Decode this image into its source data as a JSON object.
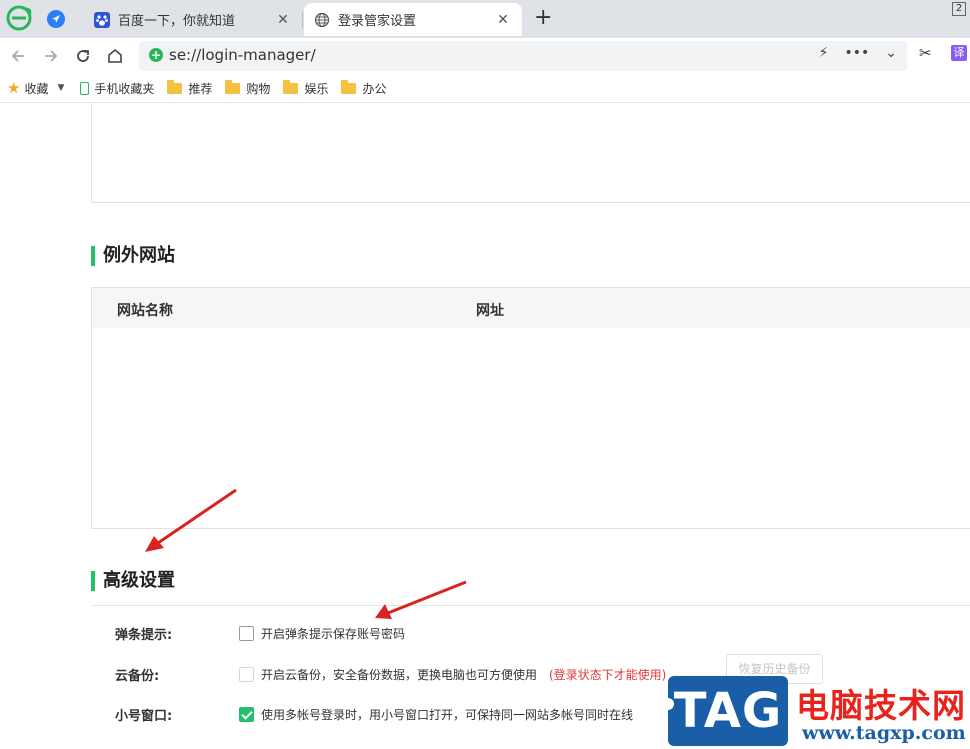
{
  "tabs": [
    {
      "label": "百度一下，你就知道",
      "icon": "baidu-paw-icon"
    },
    {
      "label": "登录管家设置",
      "icon": "globe-icon",
      "active": true
    }
  ],
  "tab_count": "2",
  "address": {
    "url": "se://login-manager/"
  },
  "bookmarks": {
    "favorites": "收藏",
    "mobile": "手机收藏夹",
    "folders": [
      "推荐",
      "购物",
      "娱乐",
      "办公"
    ]
  },
  "translate_label": "译",
  "exceptions": {
    "title": "例外网站",
    "columns": [
      "网站名称",
      "网址"
    ]
  },
  "advanced": {
    "title": "高级设置",
    "popup": {
      "label": "弹条提示:",
      "text": "开启弹条提示保存账号密码",
      "checked": false
    },
    "cloud": {
      "label": "云备份:",
      "text": "开启云备份，安全备份数据，更换电脑也可方便使用",
      "warning": "(登录状态下才能使用)",
      "button": "恢复历史备份",
      "checked": false
    },
    "small_window": {
      "label": "小号窗口:",
      "text": "使用多帐号登录时，用小号窗口打开，可保持同一网站多帐号同时在线",
      "checked": true
    }
  },
  "watermark": {
    "tag": "TAG",
    "name": "电脑技术网",
    "url": "www.tagxp.com"
  },
  "colors": {
    "accent": "#21c06a",
    "warning": "#e03a3a",
    "arrow": "#d92323"
  }
}
